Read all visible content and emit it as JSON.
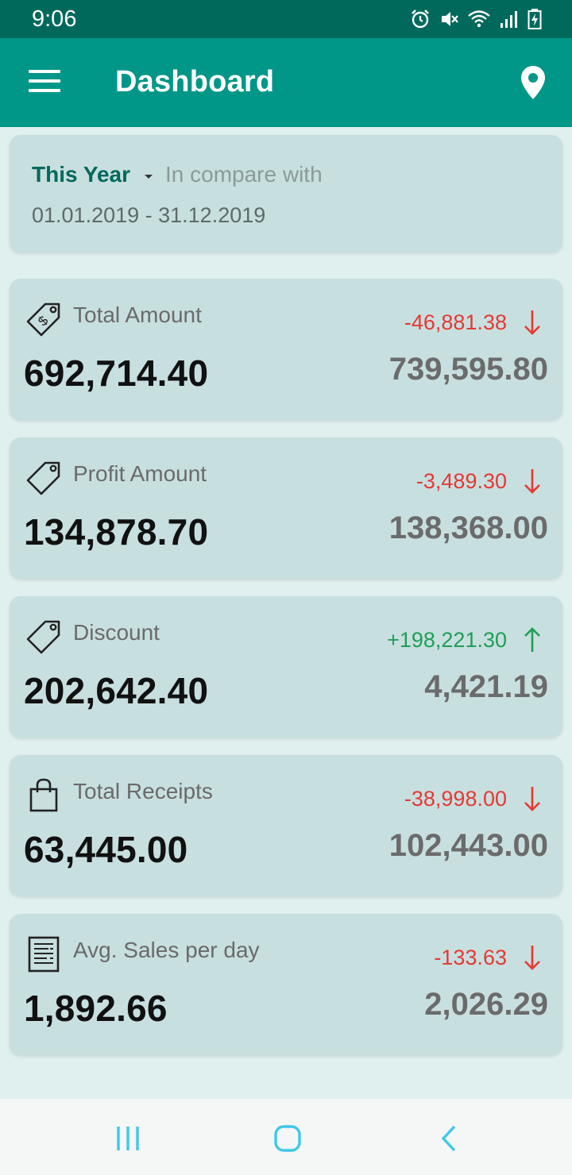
{
  "status_bar": {
    "time": "9:06",
    "icons": [
      "alarm-icon",
      "mute-icon",
      "wifi-icon",
      "signal-icon",
      "battery-charging-icon"
    ]
  },
  "app_bar": {
    "title": "Dashboard",
    "menu_icon": "hamburger-menu-icon",
    "action_icon": "location-pin-icon"
  },
  "period": {
    "selected": "This Year",
    "compare_label": "In compare with",
    "date_range": "01.01.2019 - 31.12.2019"
  },
  "metrics": [
    {
      "label": "Total Amount",
      "icon": "price-tag-dollar-icon",
      "value": "692,714.40",
      "change": "-46,881.38",
      "direction": "down",
      "previous": "739,595.80"
    },
    {
      "label": "Profit Amount",
      "icon": "tag-icon",
      "value": "134,878.70",
      "change": "-3,489.30",
      "direction": "down",
      "previous": "138,368.00"
    },
    {
      "label": "Discount",
      "icon": "tag-icon",
      "value": "202,642.40",
      "change": "+198,221.30",
      "direction": "up",
      "previous": "4,421.19"
    },
    {
      "label": "Total Receipts",
      "icon": "shopping-bag-icon",
      "value": "63,445.00",
      "change": "-38,998.00",
      "direction": "down",
      "previous": "102,443.00"
    },
    {
      "label": "Avg. Sales per day",
      "icon": "receipt-icon",
      "value": "1,892.66",
      "change": "-133.63",
      "direction": "down",
      "previous": "2,026.29"
    }
  ],
  "colors": {
    "status_bar": "#00695c",
    "app_bar": "#009688",
    "card": "#c8dfdf",
    "background": "#e0f0ef",
    "negative": "#e53935",
    "positive": "#1e9e57",
    "nav_accent": "#3ec8e8"
  },
  "nav_bar": {
    "buttons": [
      "recent-apps-icon",
      "home-icon",
      "back-icon"
    ]
  }
}
